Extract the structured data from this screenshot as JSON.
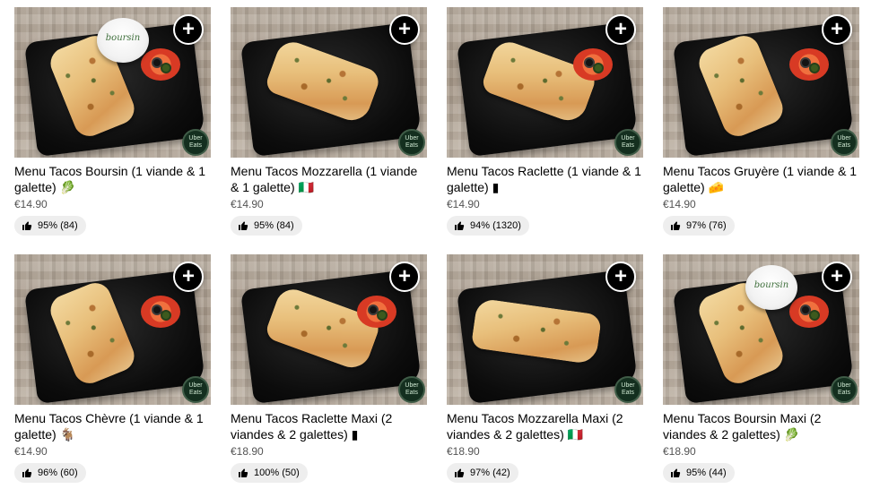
{
  "items": [
    {
      "name": " Menu Tacos Boursin  (1 viande & 1 galette) 🥬",
      "price": "€14.90",
      "rating": "95% (84)",
      "add_label": "+",
      "badge_line1": "Uber",
      "badge_line2": "Eats",
      "photo_variant": "boursin"
    },
    {
      "name": "Menu Tacos Mozzarella  (1 viande & 1 galette) 🇮🇹",
      "price": "€14.90",
      "rating": "95% (84)",
      "add_label": "+",
      "badge_line1": "Uber",
      "badge_line2": "Eats",
      "photo_variant": "plain"
    },
    {
      "name": "Menu Tacos Raclette (1 viande & 1 galette) ▮",
      "price": "€14.90",
      "rating": "94% (1320)",
      "add_label": "+",
      "badge_line1": "Uber",
      "badge_line2": "Eats",
      "photo_variant": "tomato"
    },
    {
      "name": " Menu Tacos Gruyère  (1 viande & 1 galette) 🧀",
      "price": "€14.90",
      "rating": "97% (76)",
      "add_label": "+",
      "badge_line1": "Uber",
      "badge_line2": "Eats",
      "photo_variant": "tall-tomato"
    },
    {
      "name": "Menu Tacos Chèvre  (1 viande & 1 galette) 🐐",
      "price": "€14.90",
      "rating": "96% (60)",
      "add_label": "+",
      "badge_line1": "Uber",
      "badge_line2": "Eats",
      "photo_variant": "tall-tomato"
    },
    {
      "name": " Menu Tacos Raclette Maxi (2 viandes & 2 galettes) ▮",
      "price": "€18.90",
      "rating": "100% (50)",
      "add_label": "+",
      "badge_line1": "Uber",
      "badge_line2": "Eats",
      "photo_variant": "tomato"
    },
    {
      "name": "Menu Tacos Mozzarella Maxi (2 viandes & 2 galettes) 🇮🇹",
      "price": "€18.90",
      "rating": "97% (42)",
      "add_label": "+",
      "badge_line1": "Uber",
      "badge_line2": "Eats",
      "photo_variant": "long"
    },
    {
      "name": "Menu Tacos Boursin Maxi (2 viandes & 2 galettes) 🥬",
      "price": "€18.90",
      "rating": "95% (44)",
      "add_label": "+",
      "badge_line1": "Uber",
      "badge_line2": "Eats",
      "photo_variant": "boursin"
    }
  ],
  "cheese_pot_label": "boursin",
  "colors": {
    "add_button_bg": "#000000",
    "rating_pill_bg": "#eeeeee",
    "price_text": "#545454"
  },
  "icons": {
    "add": "plus-icon",
    "rating": "thumbs-up-icon",
    "badge": "uber-eats-badge-icon"
  }
}
